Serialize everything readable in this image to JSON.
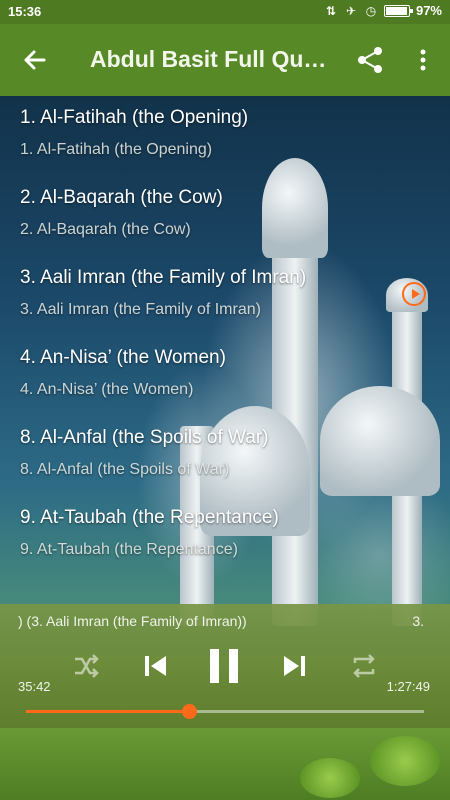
{
  "status_bar": {
    "time": "15:36",
    "battery": "97%",
    "battery_level": 0.97
  },
  "toolbar": {
    "title": "Abdul Basit Full Quran",
    "back_icon": "arrow-left-icon",
    "share_icon": "share-icon",
    "more_icon": "more-vert-icon"
  },
  "playlist": [
    {
      "title": "1. Al-Fatihah (the Opening)",
      "subtitle": "1. Al-Fatihah (the Opening)"
    },
    {
      "title": "2. Al-Baqarah (the Cow)",
      "subtitle": "2. Al-Baqarah (the Cow)"
    },
    {
      "title": "3. Aali Imran (the Family of Imran)",
      "subtitle": "3. Aali Imran (the Family of Imran)",
      "playing": true
    },
    {
      "title": "4. An-Nisa’ (the Women)",
      "subtitle": "4. An-Nisa’ (the Women)"
    },
    {
      "title": "8. Al-Anfal (the Spoils of War)",
      "subtitle": "8. Al-Anfal (the Spoils of War)"
    },
    {
      "title": "9. At-Taubah (the Repentance)",
      "subtitle": "9. At-Taubah (the Repentance)"
    }
  ],
  "player": {
    "now_playing": ") (3. Aali Imran (the Family of Imran))",
    "now_playing_right": "3.",
    "elapsed": "35:42",
    "duration": "1:27:49",
    "progress": 0.41,
    "accent_color": "#ff6a1a",
    "controls": [
      "shuffle-icon",
      "skip-previous-icon",
      "pause-icon",
      "skip-next-icon",
      "repeat-icon"
    ]
  },
  "colors": {
    "toolbar": "#578927",
    "status_bar": "#4e7a21"
  }
}
